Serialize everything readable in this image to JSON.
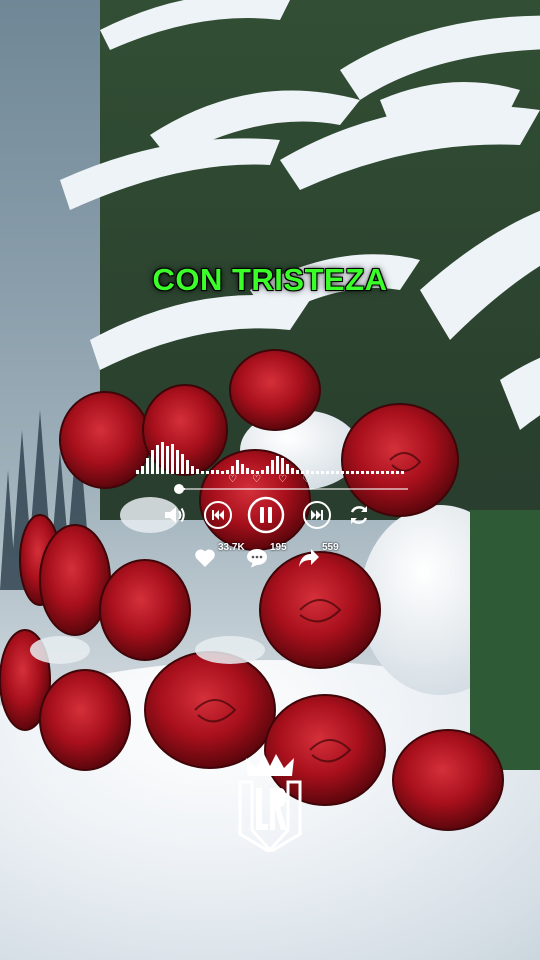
{
  "overlay": {
    "title": "CON TRISTEZA"
  },
  "player": {
    "stats": {
      "likes": "33.7K",
      "comments": "195",
      "shares": "559"
    },
    "progress_fraction": 0.02,
    "controls": [
      "volume-icon",
      "previous-icon",
      "pause-icon",
      "next-icon",
      "repeat-icon"
    ]
  },
  "logo": {
    "text": "LR"
  },
  "colors": {
    "title": "#3bff28",
    "rose": "#a8101c",
    "snow": "#f2f5f8"
  }
}
